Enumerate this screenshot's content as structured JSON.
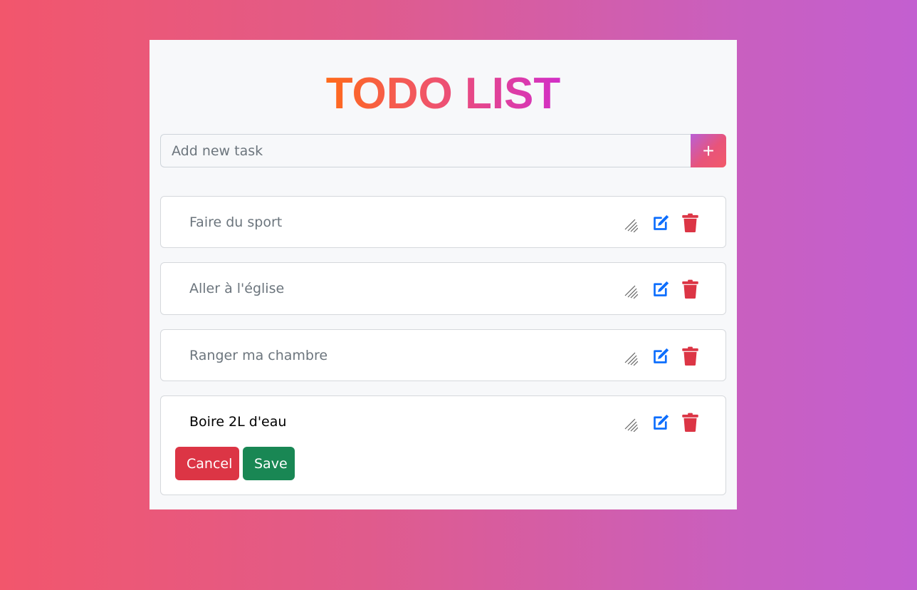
{
  "header": {
    "title": "TODO LIST"
  },
  "add_task": {
    "placeholder": "Add new task",
    "add_button_label": "+"
  },
  "tasks": [
    {
      "text": "Faire du sport",
      "editing": false
    },
    {
      "text": "Aller à l'église",
      "editing": false
    },
    {
      "text": "Ranger ma chambre",
      "editing": false
    },
    {
      "text": "Boire 2L d'eau",
      "editing": true
    }
  ],
  "edit_actions": {
    "cancel_label": "Cancel",
    "save_label": "Save"
  },
  "colors": {
    "edit_icon": "#0d6efd",
    "trash_icon": "#dc3545",
    "cancel": "#dc3545",
    "save": "#198754"
  },
  "icons": {
    "resize": "resize-handle-icon",
    "edit": "edit-icon",
    "delete": "trash-icon"
  }
}
